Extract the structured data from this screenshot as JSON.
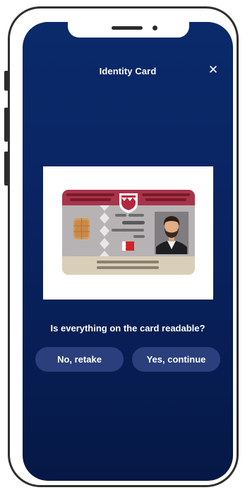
{
  "header": {
    "title": "Identity Card",
    "close_glyph": "✕"
  },
  "prompt": {
    "question": "Is everything on the card readable?"
  },
  "actions": {
    "retake_label": "No, retake",
    "continue_label": "Yes, continue"
  },
  "colors": {
    "screen_background": "#0a2462",
    "button_background": "#2a3f7c",
    "card_header": "#a8344a",
    "card_body": "#b7b3b4",
    "card_footer": "#d9cfb9"
  },
  "icons": {
    "card_illustration": "id-card-illustration",
    "emblem": "emblem-icon",
    "chip": "chip-icon",
    "flag": "flag-icon",
    "portrait": "portrait-icon"
  }
}
